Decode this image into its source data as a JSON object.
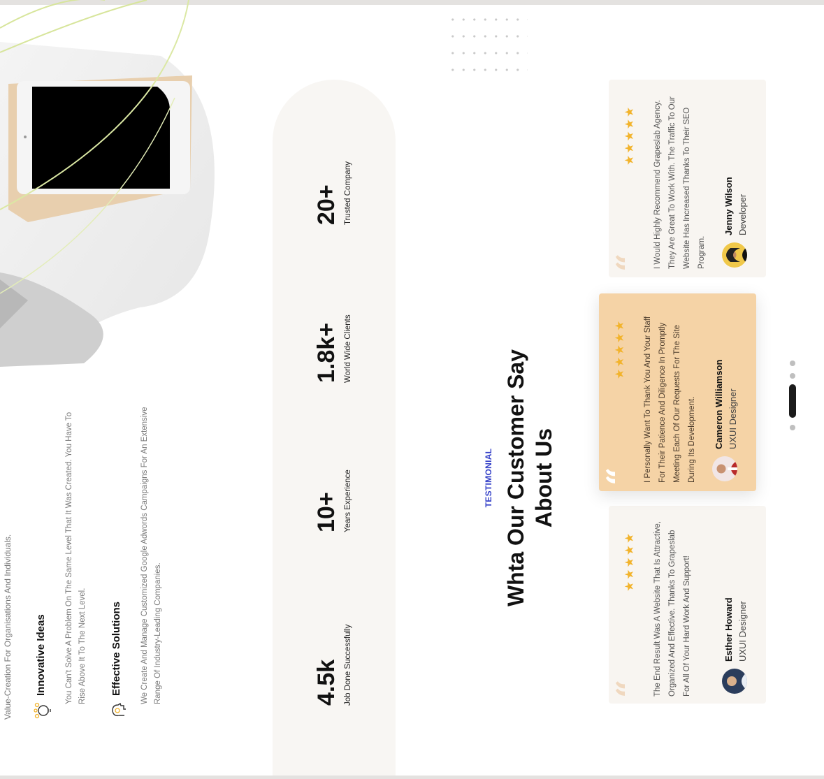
{
  "features": {
    "intro_line1": "Value-Creation For Organisations And Individuals.",
    "items": [
      {
        "title": "Innovative Ideas",
        "desc": "You Can't Solve A Problem On The Same Level That It Was Created. You Have To Rise Above It To The Next Level."
      },
      {
        "title": "Effective Solutions",
        "desc": "We Create And Manage Customized Google Adwords Campaigns For An Extensive Range Of Industry-Leading Companies."
      }
    ]
  },
  "stats": [
    {
      "value": "4.5k",
      "label": "Job Done Successfully"
    },
    {
      "value": "10+",
      "label": "Years Experience"
    },
    {
      "value": "1.8k+",
      "label": "World Wide Clients"
    },
    {
      "value": "20+",
      "label": "Trusted Company"
    }
  ],
  "testimonial_section": {
    "eyebrow": "TESTIMONIAL",
    "title": "Whta Our Customer Say About Us"
  },
  "testimonials": [
    {
      "text": "The End Result Was A Website That Is Attractive, Organized And Effective. Thanks To Grapeslab For All Of Your Hard Work And Support!",
      "name": "Esther Howard",
      "role": "UXUI Designer",
      "stars": "★★★★★",
      "quote": "“"
    },
    {
      "text": "I Personally Want To Thank You And Your Staff For Their Patience And Diligence In Promptly Meeting Each Of Our Requests For The Site During Its Development.",
      "name": "Cameron Williamson",
      "role": "UXUI Designer",
      "stars": "★★★★★",
      "quote": "“"
    },
    {
      "text": "I Would Highly Recommend Grapeslab Agency. They Are Great To Work With. The Traffic To Our Website Has Increased Thanks To Their SEO Program.",
      "name": "Jenny Wilson",
      "role": "Developer",
      "stars": "★★★★★",
      "quote": "“"
    }
  ],
  "colors": {
    "accent_blue": "#3440c8",
    "star_gold": "#f2b32b",
    "highlight_card": "#f5d3a6",
    "card_bg": "#f8f5f1"
  }
}
